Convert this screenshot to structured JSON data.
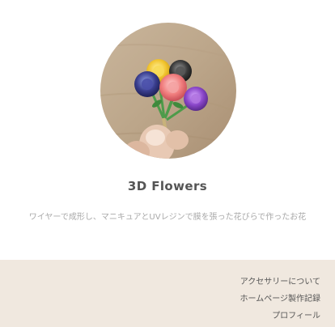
{
  "profile": {
    "image_alt": "3D flowers made of wire and UV resin held in a hand",
    "title": "3D Flowers",
    "description": "ワイヤーで成形し、マニキュアとUVレジンで膜を張った花びらで作ったお花"
  },
  "footer": {
    "links": [
      {
        "label": "アクセサリーについて"
      },
      {
        "label": "ホームページ製作記録"
      },
      {
        "label": "プロフィール"
      }
    ]
  },
  "colors": {
    "footer_bg": "#f0e8df",
    "title_text": "#555555",
    "desc_text": "#a9a9a9"
  }
}
